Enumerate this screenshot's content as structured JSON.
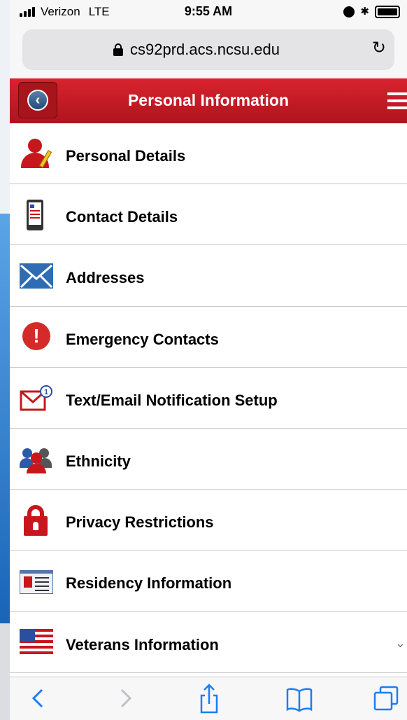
{
  "status_bar": {
    "carrier": "Verizon",
    "network": "LTE",
    "time": "9:55 AM",
    "bluetooth": "✱"
  },
  "browser": {
    "url": "cs92prd.acs.ncsu.edu",
    "reload_icon": "↻"
  },
  "header": {
    "back_icon": "‹",
    "title": "Personal Information"
  },
  "menu_items": [
    {
      "label": "Personal Details",
      "icon": "person-edit-icon"
    },
    {
      "label": "Contact Details",
      "icon": "phone-icon"
    },
    {
      "label": "Addresses",
      "icon": "envelope-icon"
    },
    {
      "label": "Emergency Contacts",
      "icon": "alert-icon"
    },
    {
      "label": "Text/Email Notification Setup",
      "icon": "mail-notification-icon"
    },
    {
      "label": "Ethnicity",
      "icon": "group-icon"
    },
    {
      "label": "Privacy Restrictions",
      "icon": "padlock-icon"
    },
    {
      "label": "Residency Information",
      "icon": "id-card-icon"
    },
    {
      "label": "Veterans Information",
      "icon": "us-flag-icon"
    }
  ],
  "notification_badge": "1",
  "colors": {
    "header_red": "#c8161d",
    "back_button_blue": "#2b5aa8",
    "envelope_blue": "#2e6db4"
  }
}
